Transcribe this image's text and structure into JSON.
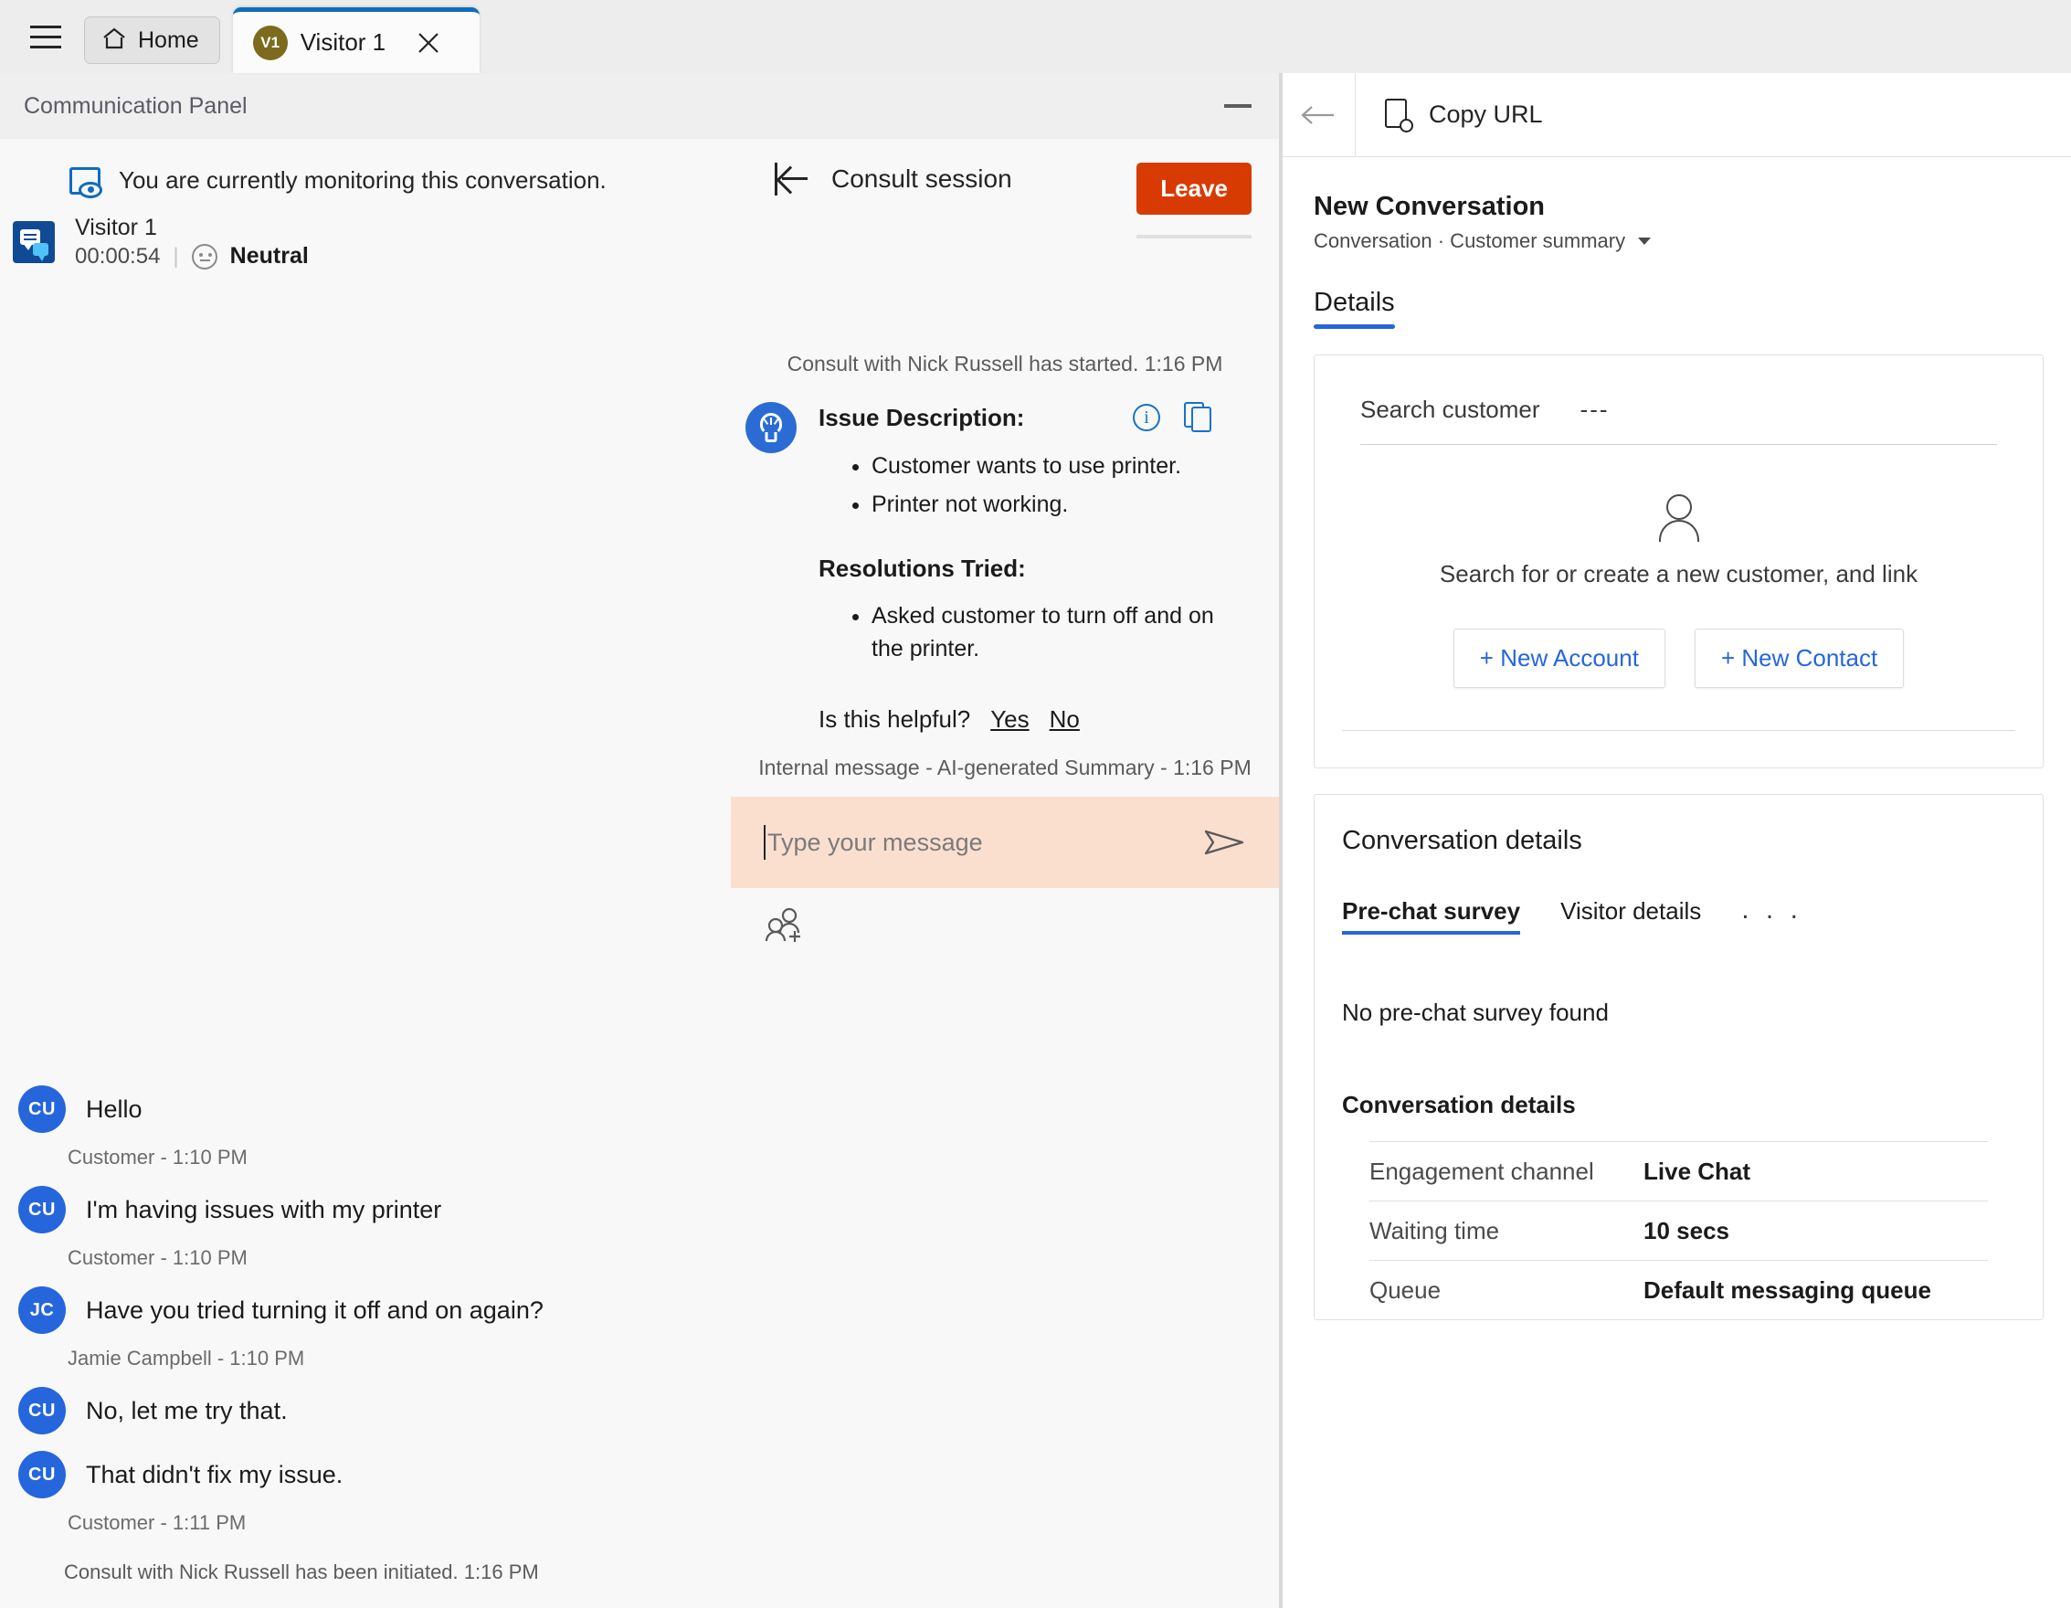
{
  "tabstrip": {
    "menu_icon": "hamburger-icon",
    "home_tab": {
      "label": "Home",
      "icon": "home-icon"
    },
    "visitor_tab": {
      "avatar": "V1",
      "label": "Visitor 1",
      "close_icon": "close-icon"
    }
  },
  "communication_panel": {
    "title": "Communication Panel",
    "minimize_icon": "minimize-icon",
    "monitoring": {
      "icon": "monitor-eye-icon",
      "text": "You are currently monitoring this conversation."
    },
    "visitor": {
      "icon": "chat-bubbles-icon",
      "name": "Visitor 1",
      "timer": "00:00:54",
      "sentiment_icon": "neutral-face-icon",
      "sentiment": "Neutral"
    },
    "messages": [
      {
        "initials": "CU",
        "text": "Hello",
        "meta": "Customer - 1:10 PM"
      },
      {
        "initials": "CU",
        "text": "I'm having issues with my printer",
        "meta": "Customer - 1:10 PM"
      },
      {
        "initials": "JC",
        "text": "Have you tried turning it off and on again?",
        "meta": "Jamie Campbell - 1:10 PM"
      },
      {
        "initials": "CU",
        "text": "No, let me try that.",
        "meta": ""
      },
      {
        "initials": "CU",
        "text": "That didn't fix my issue.",
        "meta": "Customer - 1:11 PM"
      }
    ],
    "system_note": "Consult with Nick Russell has been initiated. 1:16 PM"
  },
  "consult": {
    "collapse_icon": "collapse-panel-icon",
    "label": "Consult session",
    "leave_button": "Leave",
    "started_note": "Consult with Nick Russell has started. 1:16 PM",
    "summary": {
      "icon": "lightbulb-icon",
      "info_icon": "info-icon",
      "copy_icon": "copy-icon",
      "issue_heading": "Issue Description:",
      "issue_items": [
        "Customer wants to use printer.",
        "Printer not working."
      ],
      "resolutions_heading": "Resolutions Tried:",
      "resolution_items": [
        "Asked customer to turn off and on the printer."
      ],
      "helpful_prompt": "Is this helpful?",
      "helpful_yes": "Yes",
      "helpful_no": "No",
      "meta": "Internal message - AI-generated Summary - 1:16 PM"
    },
    "composer": {
      "placeholder": "Type your message",
      "send_icon": "send-icon",
      "add_person_icon": "add-person-icon"
    }
  },
  "right_panel": {
    "back_icon": "back-arrow-icon",
    "copy_url": {
      "icon": "copy-url-icon",
      "label": "Copy URL"
    },
    "record_title": "New Conversation",
    "record_subtitle": "Conversation · Customer summary",
    "chevron_icon": "chevron-down-icon",
    "tab": "Details",
    "customer_card": {
      "search_label": "Search customer",
      "search_value": "---",
      "person_icon": "person-icon",
      "empty_text": "Search for or create a new customer, and link",
      "new_account_button": "+ New Account",
      "new_contact_button": "+ New Contact"
    },
    "conversation_card": {
      "title": "Conversation details",
      "tabs": [
        {
          "label": "Pre-chat survey",
          "active": true
        },
        {
          "label": "Visitor details",
          "active": false
        },
        {
          "label": ". . .",
          "active": false
        }
      ],
      "empty_message": "No pre-chat survey found",
      "details_heading": "Conversation details",
      "rows": [
        {
          "key": "Engagement channel",
          "value": "Live Chat"
        },
        {
          "key": "Waiting time",
          "value": "10 secs"
        },
        {
          "key": "Queue",
          "value": "Default messaging queue"
        }
      ]
    }
  },
  "colors": {
    "accent_blue": "#2566dc",
    "tab_blue": "#0f6cbd",
    "leave_orange": "#d83b01",
    "composer_peach": "#fbdfce",
    "visitor_avatar_gold": "#7c6a1f"
  }
}
